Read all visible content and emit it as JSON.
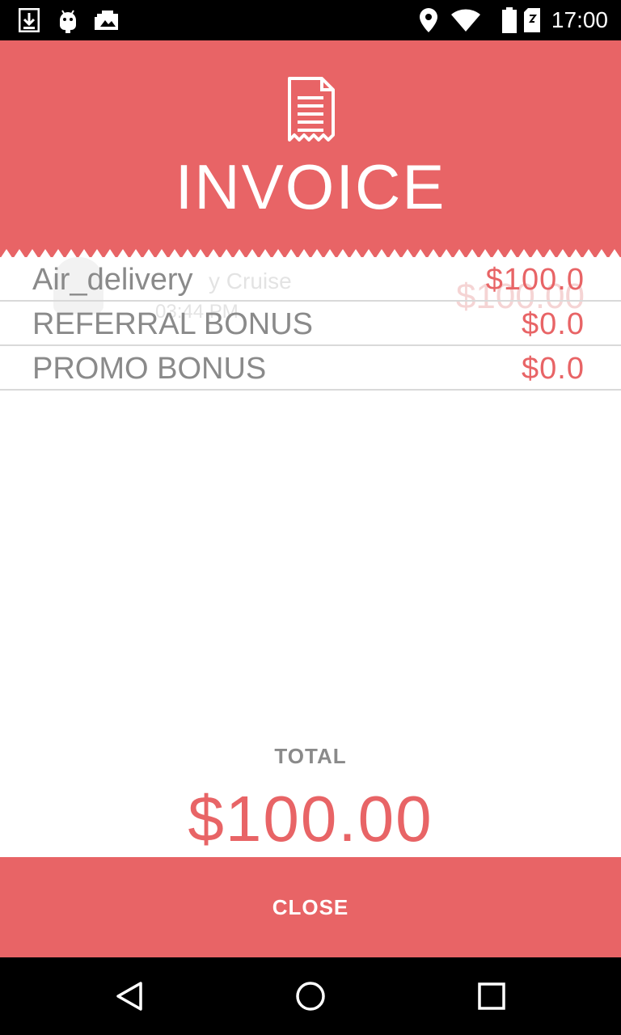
{
  "status_bar": {
    "time": "17:00",
    "left_icons": [
      "download-icon",
      "android-icon",
      "photo-icon"
    ],
    "right_icons": [
      "location-icon",
      "wifi-icon",
      "sim-icon",
      "battery-icon"
    ]
  },
  "header": {
    "icon": "receipt-icon",
    "title": "INVOICE",
    "color": "#e86466"
  },
  "background_ghost": {
    "name": "y Cruise",
    "time": "03:44 PM",
    "amount": "$100.00"
  },
  "items": [
    {
      "label": "Air_delivery",
      "amount": "$100.0"
    },
    {
      "label": "REFERRAL BONUS",
      "amount": "$0.0"
    },
    {
      "label": "PROMO BONUS",
      "amount": "$0.0"
    }
  ],
  "total": {
    "label": "TOTAL",
    "value": "$100.00"
  },
  "close_button": {
    "label": "CLOSE"
  },
  "nav_bar": {
    "back": "back-icon",
    "home": "home-icon",
    "recents": "recents-icon"
  }
}
